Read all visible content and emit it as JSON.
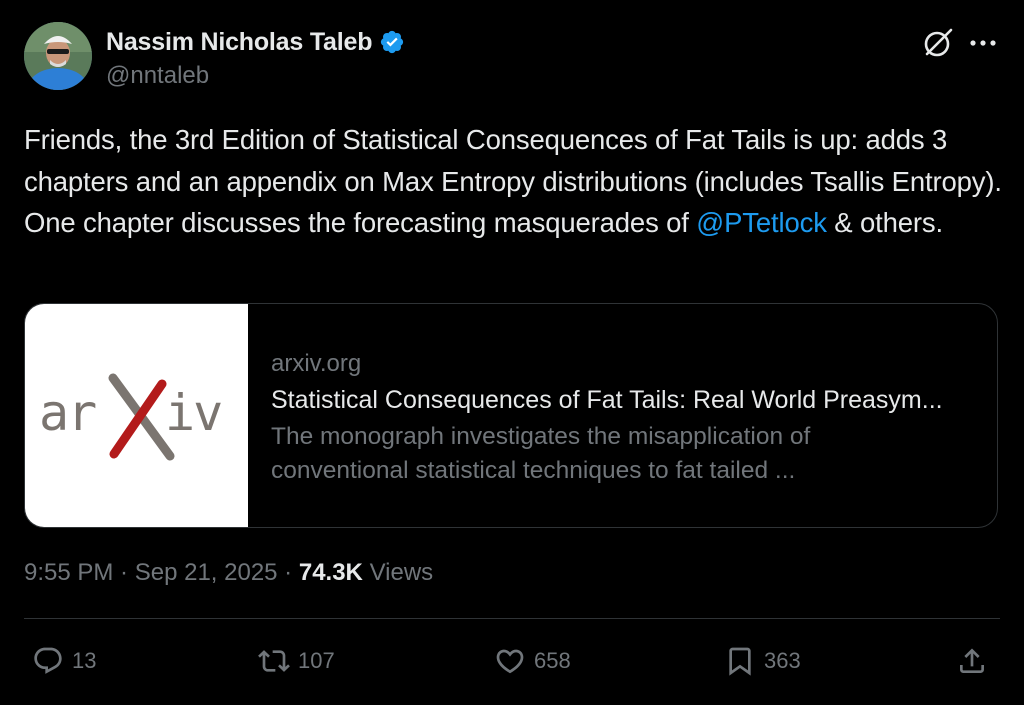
{
  "author": {
    "display_name": "Nassim Nicholas Taleb",
    "handle": "@nntaleb",
    "verified": true
  },
  "tweet": {
    "text_before_mention": "Friends, the 3rd Edition of Statistical Consequences of Fat Tails is up: adds 3 chapters and an appendix on Max Entropy distributions (includes Tsallis Entropy). One chapter discusses the forecasting masquerades of ",
    "mention": "@PTetlock",
    "text_after_mention": " & others."
  },
  "link_card": {
    "logo_text": "arXiv",
    "domain": "arxiv.org",
    "title": "Statistical Consequences of Fat Tails: Real World Preasym...",
    "description": "The monograph investigates the misapplication of conventional statistical techniques to fat tailed ..."
  },
  "meta": {
    "time": "9:55 PM",
    "separator": " · ",
    "date": "Sep 21, 2025",
    "views_count": "74.3K",
    "views_label": "Views"
  },
  "actions": {
    "replies": "13",
    "reposts": "107",
    "likes": "658",
    "bookmarks": "363"
  },
  "icons": {
    "verified": "verified-badge-icon",
    "grok": "grok-icon",
    "more": "more-icon",
    "reply": "reply-icon",
    "repost": "repost-icon",
    "like": "heart-icon",
    "bookmark": "bookmark-icon",
    "share": "share-icon"
  },
  "colors": {
    "background": "#000000",
    "text_primary": "#e7e9ea",
    "text_secondary": "#71767b",
    "link": "#1d9bf0",
    "border": "#2f3336",
    "verified": "#1d9bf0",
    "arxiv_red": "#b31b1b",
    "arxiv_gray": "#7b7570"
  }
}
